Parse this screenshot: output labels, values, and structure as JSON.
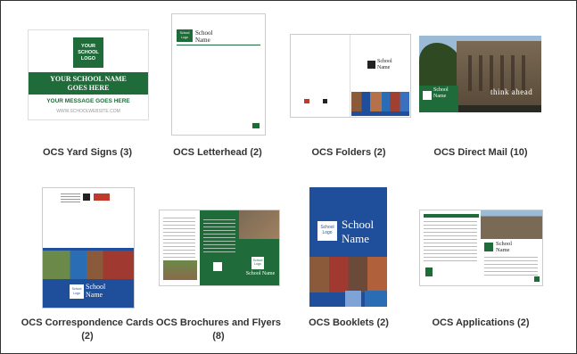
{
  "colors": {
    "green": "#1f6b3a",
    "blue": "#1f4f9a",
    "caption": "#333333"
  },
  "products": [
    {
      "caption": "OCS Yard Signs (3)"
    },
    {
      "caption": "OCS Letterhead (2)"
    },
    {
      "caption": "OCS Folders (2)"
    },
    {
      "caption": "OCS Direct Mail (10)"
    },
    {
      "caption": "OCS Correspondence Cards (2)"
    },
    {
      "caption": "OCS Brochures and Flyers (8)"
    },
    {
      "caption": "OCS Booklets (2)"
    },
    {
      "caption": "OCS Applications (2)"
    }
  ],
  "yard_sign": {
    "logo": "YOUR SCHOOL LOGO",
    "name": "YOUR SCHOOL NAME GOES HERE",
    "message": "YOUR MESSAGE GOES HERE",
    "website": "WWW.SCHOOLWEBSITE.COM"
  },
  "school_logo": "School Logo",
  "school_name": "School Name",
  "school_word": "School",
  "name_word": "Name",
  "direct_mail_tagline": "think ahead"
}
